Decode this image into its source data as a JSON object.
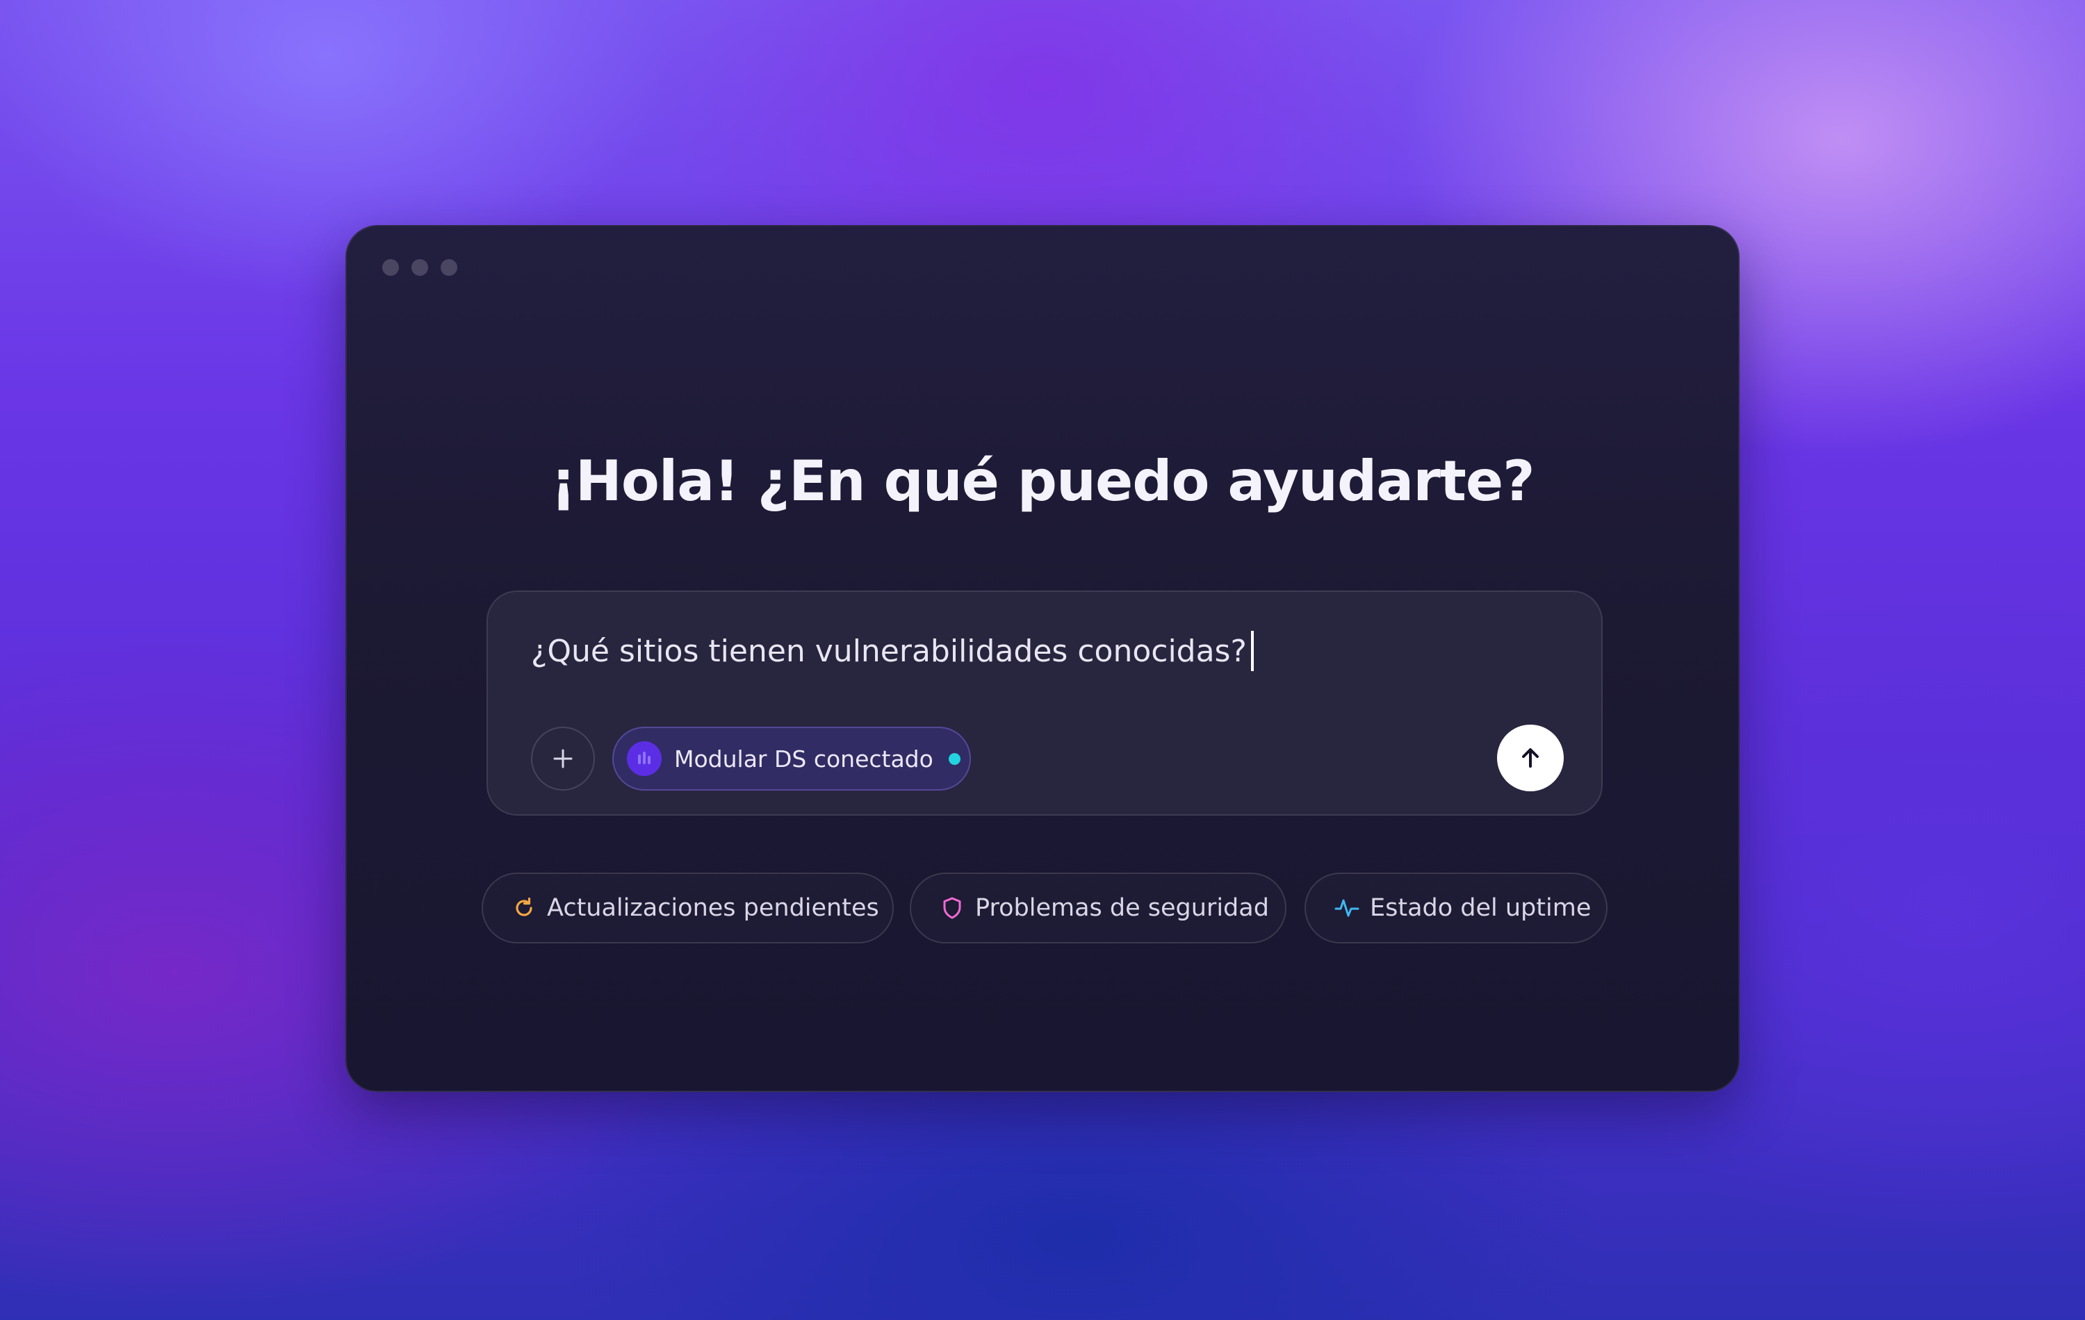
{
  "window": {
    "greeting": "¡Hola! ¿En qué puedo ayudarte?"
  },
  "composer": {
    "input_value": "¿Qué sitios tienen vulnerabilidades conocidas?",
    "add_button_icon": "plus-icon",
    "source_chip": {
      "label": "Modular DS conectado",
      "logo_icon": "bars-logo-icon",
      "status": "connected",
      "status_color": "#22d3e0"
    },
    "send_button_icon": "arrow-up-icon"
  },
  "suggestions": [
    {
      "label": "Actualizaciones pendientes",
      "icon": "refresh-icon",
      "icon_color": "#f5a742"
    },
    {
      "label": "Problemas de seguridad",
      "icon": "shield-icon",
      "icon_color": "#f06bd0"
    },
    {
      "label": "Estado del uptime",
      "icon": "activity-icon",
      "icon_color": "#3fb8f0"
    }
  ],
  "colors": {
    "window_bg": "#1c1933",
    "composer_bg": "#28253f",
    "chip_bg": "#312c63",
    "accent": "#5b2ee6"
  }
}
